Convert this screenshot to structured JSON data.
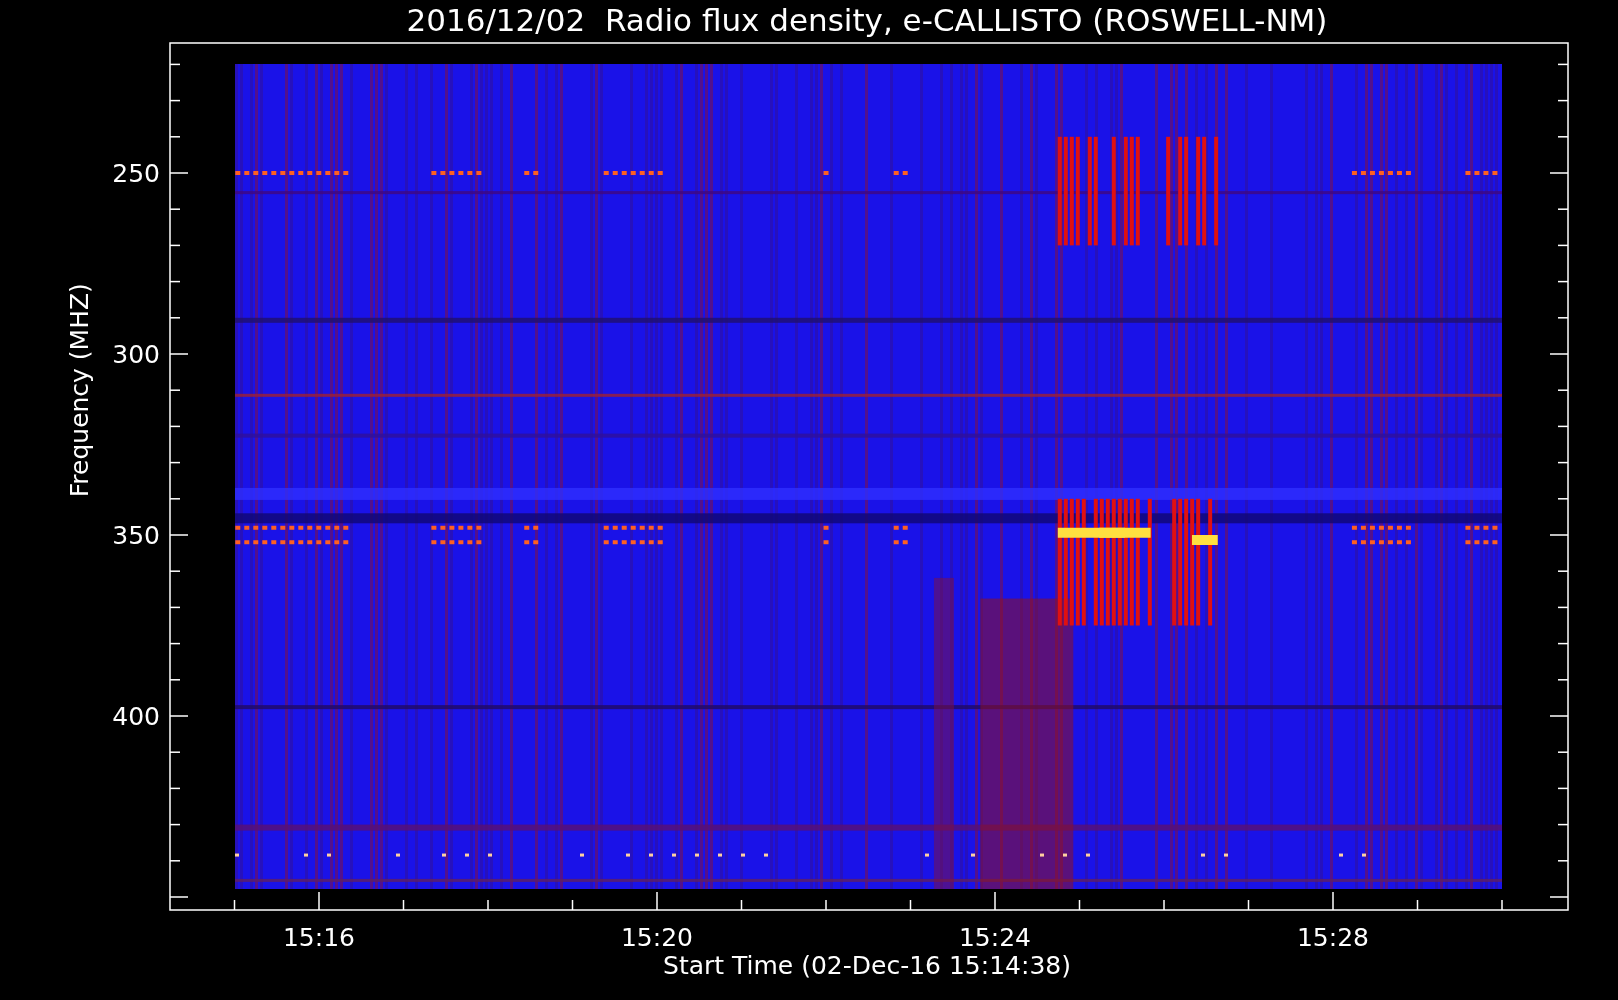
{
  "title": "2016/12/02  Radio flux density, e-CALLISTO (ROSWELL-NM)",
  "y_axis": {
    "label": "Frequency (MHZ)",
    "ticks": [
      "250",
      "300",
      "350",
      "400"
    ]
  },
  "x_axis": {
    "label": "Start Time (02-Dec-16 15:14:38)",
    "ticks": [
      "15:16",
      "15:20",
      "15:24",
      "15:28"
    ]
  }
}
